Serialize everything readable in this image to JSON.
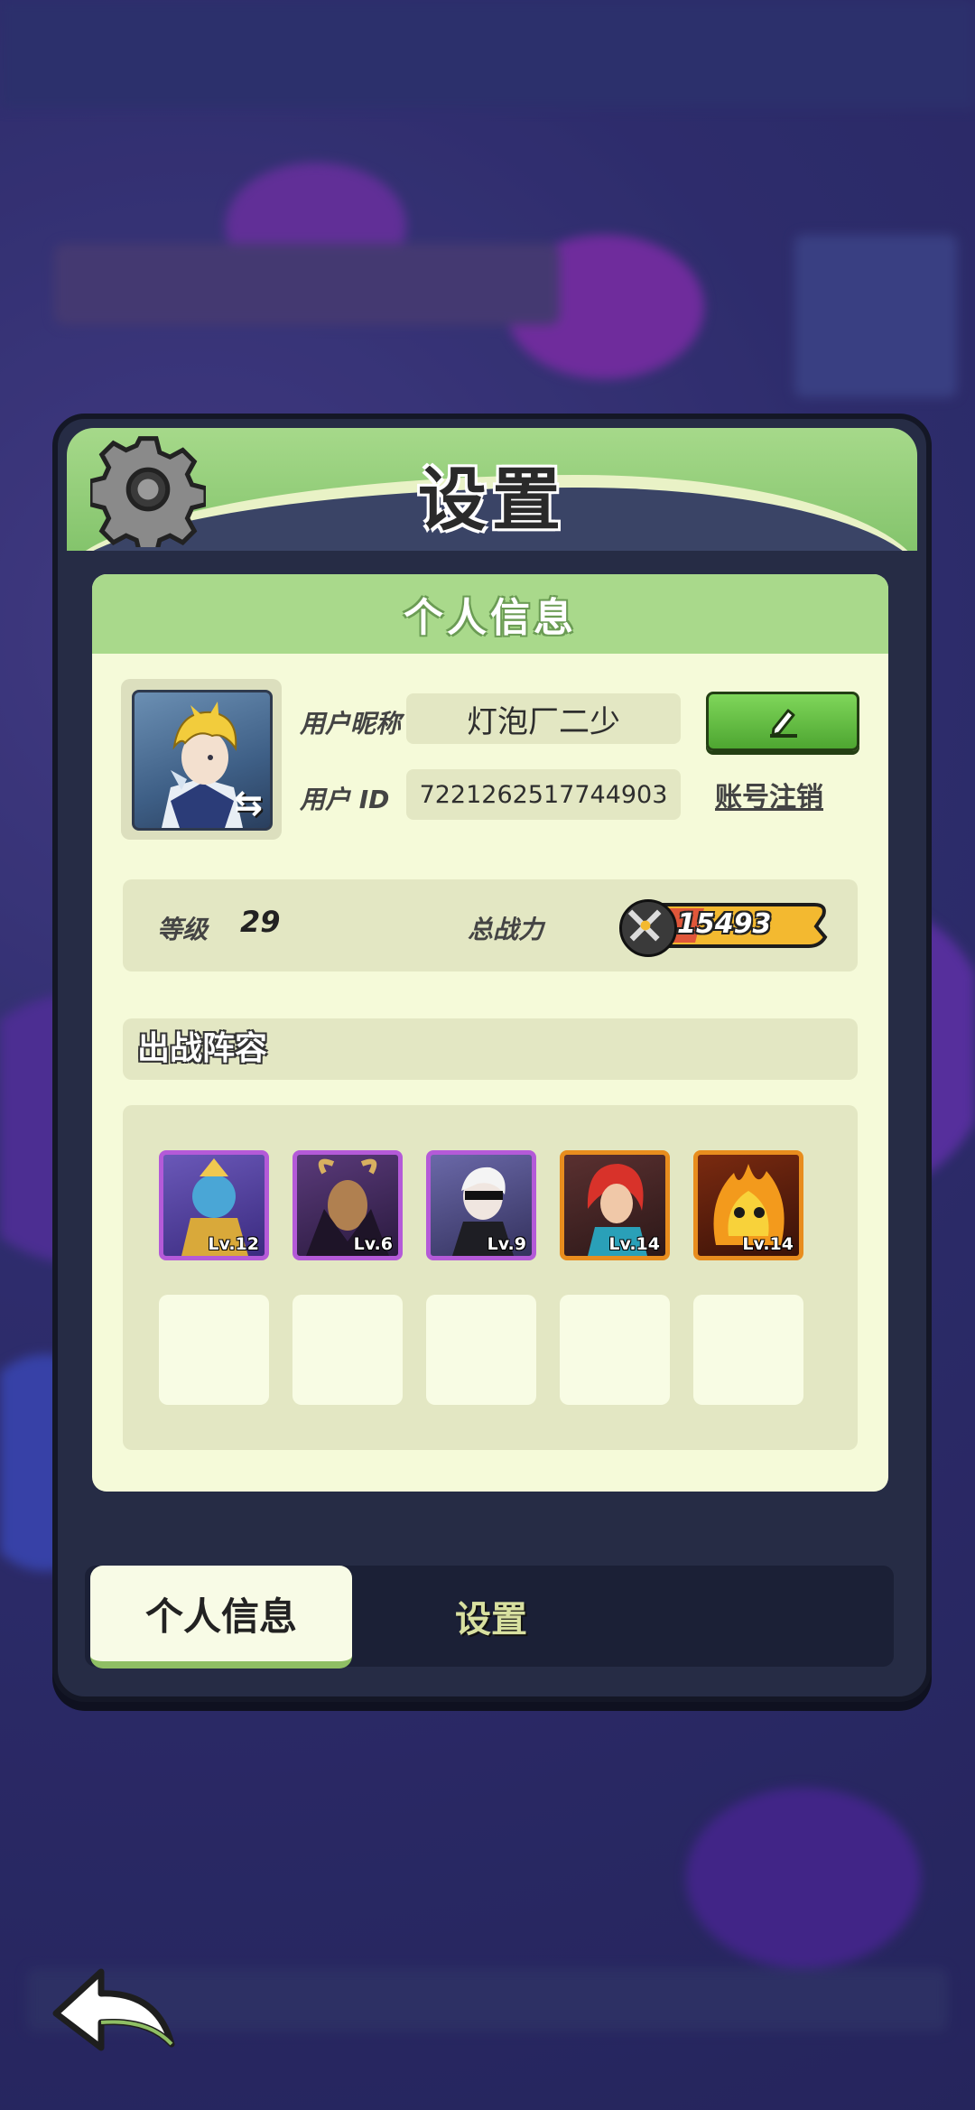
{
  "panel": {
    "title": "设置",
    "section_title": "个人信息"
  },
  "profile": {
    "nickname_label": "用户昵称",
    "nickname": "灯泡厂二少",
    "id_label": "用户 ID",
    "user_id": "7221262517744903",
    "delete_account": "账号注销",
    "level_label": "等级",
    "level": "29",
    "power_label": "总战力",
    "power": "15493"
  },
  "lineup": {
    "title": "出战阵容",
    "heroes": [
      {
        "level": "Lv.12",
        "rarity": "purple"
      },
      {
        "level": "Lv.6",
        "rarity": "purple"
      },
      {
        "level": "Lv.9",
        "rarity": "purple"
      },
      {
        "level": "Lv.14",
        "rarity": "orange"
      },
      {
        "level": "Lv.14",
        "rarity": "orange"
      }
    ]
  },
  "tabs": {
    "active": "个人信息",
    "other": "设置"
  },
  "icons": {
    "gear": "gear-icon",
    "edit": "pencil-icon",
    "swap": "swap-icon",
    "back": "back-arrow-icon",
    "power": "crossed-swords-icon"
  },
  "colors": {
    "header_green": "#a6d98a",
    "panel_dark": "#262c45",
    "card_bg": "#f5fad9",
    "purple_frame": "#b45ad8",
    "orange_frame": "#e88d1e"
  }
}
